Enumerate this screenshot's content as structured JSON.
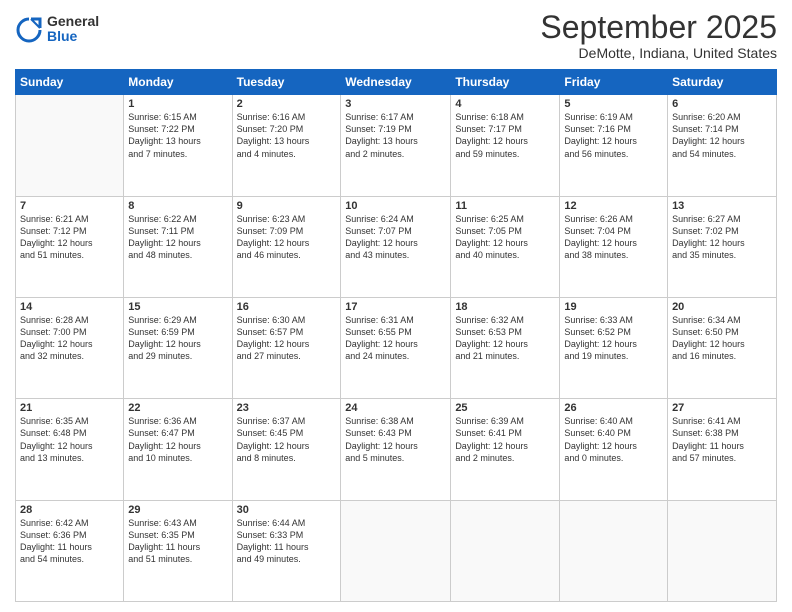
{
  "header": {
    "logo_general": "General",
    "logo_blue": "Blue",
    "month_title": "September 2025",
    "location": "DeMotte, Indiana, United States"
  },
  "weekdays": [
    "Sunday",
    "Monday",
    "Tuesday",
    "Wednesday",
    "Thursday",
    "Friday",
    "Saturday"
  ],
  "weeks": [
    [
      {
        "day": "",
        "info": ""
      },
      {
        "day": "1",
        "info": "Sunrise: 6:15 AM\nSunset: 7:22 PM\nDaylight: 13 hours\nand 7 minutes."
      },
      {
        "day": "2",
        "info": "Sunrise: 6:16 AM\nSunset: 7:20 PM\nDaylight: 13 hours\nand 4 minutes."
      },
      {
        "day": "3",
        "info": "Sunrise: 6:17 AM\nSunset: 7:19 PM\nDaylight: 13 hours\nand 2 minutes."
      },
      {
        "day": "4",
        "info": "Sunrise: 6:18 AM\nSunset: 7:17 PM\nDaylight: 12 hours\nand 59 minutes."
      },
      {
        "day": "5",
        "info": "Sunrise: 6:19 AM\nSunset: 7:16 PM\nDaylight: 12 hours\nand 56 minutes."
      },
      {
        "day": "6",
        "info": "Sunrise: 6:20 AM\nSunset: 7:14 PM\nDaylight: 12 hours\nand 54 minutes."
      }
    ],
    [
      {
        "day": "7",
        "info": "Sunrise: 6:21 AM\nSunset: 7:12 PM\nDaylight: 12 hours\nand 51 minutes."
      },
      {
        "day": "8",
        "info": "Sunrise: 6:22 AM\nSunset: 7:11 PM\nDaylight: 12 hours\nand 48 minutes."
      },
      {
        "day": "9",
        "info": "Sunrise: 6:23 AM\nSunset: 7:09 PM\nDaylight: 12 hours\nand 46 minutes."
      },
      {
        "day": "10",
        "info": "Sunrise: 6:24 AM\nSunset: 7:07 PM\nDaylight: 12 hours\nand 43 minutes."
      },
      {
        "day": "11",
        "info": "Sunrise: 6:25 AM\nSunset: 7:05 PM\nDaylight: 12 hours\nand 40 minutes."
      },
      {
        "day": "12",
        "info": "Sunrise: 6:26 AM\nSunset: 7:04 PM\nDaylight: 12 hours\nand 38 minutes."
      },
      {
        "day": "13",
        "info": "Sunrise: 6:27 AM\nSunset: 7:02 PM\nDaylight: 12 hours\nand 35 minutes."
      }
    ],
    [
      {
        "day": "14",
        "info": "Sunrise: 6:28 AM\nSunset: 7:00 PM\nDaylight: 12 hours\nand 32 minutes."
      },
      {
        "day": "15",
        "info": "Sunrise: 6:29 AM\nSunset: 6:59 PM\nDaylight: 12 hours\nand 29 minutes."
      },
      {
        "day": "16",
        "info": "Sunrise: 6:30 AM\nSunset: 6:57 PM\nDaylight: 12 hours\nand 27 minutes."
      },
      {
        "day": "17",
        "info": "Sunrise: 6:31 AM\nSunset: 6:55 PM\nDaylight: 12 hours\nand 24 minutes."
      },
      {
        "day": "18",
        "info": "Sunrise: 6:32 AM\nSunset: 6:53 PM\nDaylight: 12 hours\nand 21 minutes."
      },
      {
        "day": "19",
        "info": "Sunrise: 6:33 AM\nSunset: 6:52 PM\nDaylight: 12 hours\nand 19 minutes."
      },
      {
        "day": "20",
        "info": "Sunrise: 6:34 AM\nSunset: 6:50 PM\nDaylight: 12 hours\nand 16 minutes."
      }
    ],
    [
      {
        "day": "21",
        "info": "Sunrise: 6:35 AM\nSunset: 6:48 PM\nDaylight: 12 hours\nand 13 minutes."
      },
      {
        "day": "22",
        "info": "Sunrise: 6:36 AM\nSunset: 6:47 PM\nDaylight: 12 hours\nand 10 minutes."
      },
      {
        "day": "23",
        "info": "Sunrise: 6:37 AM\nSunset: 6:45 PM\nDaylight: 12 hours\nand 8 minutes."
      },
      {
        "day": "24",
        "info": "Sunrise: 6:38 AM\nSunset: 6:43 PM\nDaylight: 12 hours\nand 5 minutes."
      },
      {
        "day": "25",
        "info": "Sunrise: 6:39 AM\nSunset: 6:41 PM\nDaylight: 12 hours\nand 2 minutes."
      },
      {
        "day": "26",
        "info": "Sunrise: 6:40 AM\nSunset: 6:40 PM\nDaylight: 12 hours\nand 0 minutes."
      },
      {
        "day": "27",
        "info": "Sunrise: 6:41 AM\nSunset: 6:38 PM\nDaylight: 11 hours\nand 57 minutes."
      }
    ],
    [
      {
        "day": "28",
        "info": "Sunrise: 6:42 AM\nSunset: 6:36 PM\nDaylight: 11 hours\nand 54 minutes."
      },
      {
        "day": "29",
        "info": "Sunrise: 6:43 AM\nSunset: 6:35 PM\nDaylight: 11 hours\nand 51 minutes."
      },
      {
        "day": "30",
        "info": "Sunrise: 6:44 AM\nSunset: 6:33 PM\nDaylight: 11 hours\nand 49 minutes."
      },
      {
        "day": "",
        "info": ""
      },
      {
        "day": "",
        "info": ""
      },
      {
        "day": "",
        "info": ""
      },
      {
        "day": "",
        "info": ""
      }
    ]
  ]
}
